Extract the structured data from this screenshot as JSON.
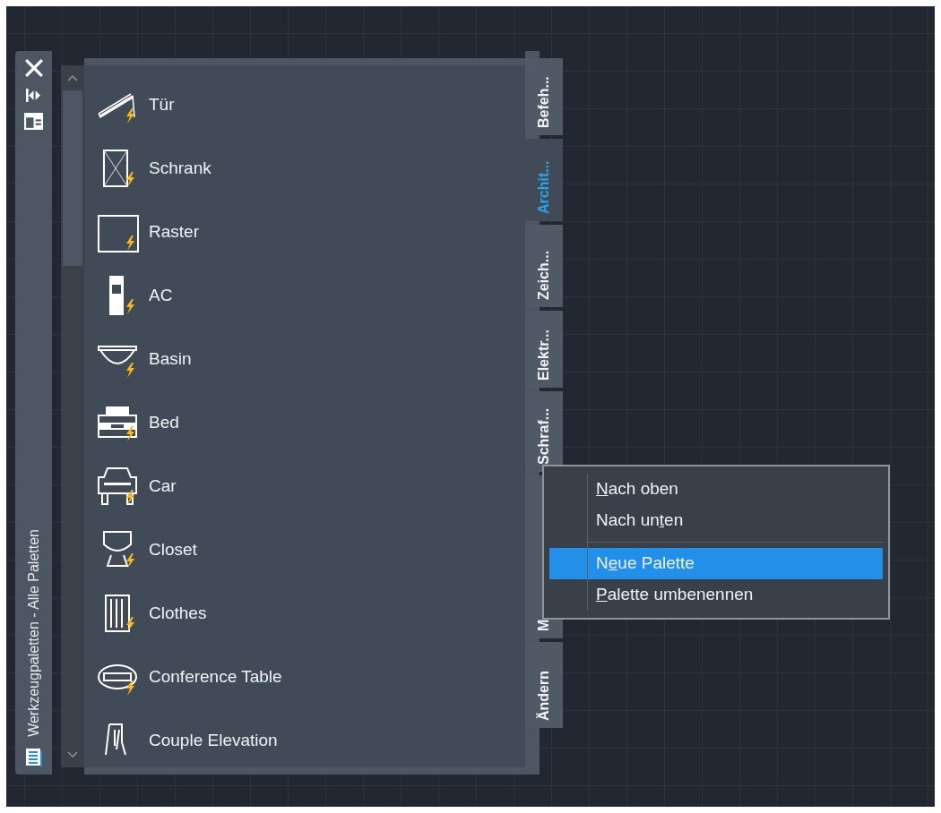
{
  "palette": {
    "title": "Werkzeugpaletten - Alle Paletten",
    "items": [
      {
        "label": "Tür"
      },
      {
        "label": "Schrank"
      },
      {
        "label": "Raster"
      },
      {
        "label": "AC"
      },
      {
        "label": "Basin"
      },
      {
        "label": "Bed"
      },
      {
        "label": "Car"
      },
      {
        "label": "Closet"
      },
      {
        "label": "Clothes"
      },
      {
        "label": "Conference Table"
      },
      {
        "label": "Couple Elevation"
      }
    ],
    "tabs": [
      {
        "label": "Befeh...",
        "selected": false
      },
      {
        "label": "Archit...",
        "selected": true
      },
      {
        "label": "Zeich...",
        "selected": false
      },
      {
        "label": "Elektr...",
        "selected": false
      },
      {
        "label": "Schraf...",
        "selected": false
      },
      {
        "label": "M",
        "selected": false
      },
      {
        "label": "Ändern",
        "selected": false
      }
    ]
  },
  "context_menu": {
    "items": [
      {
        "kind": "item",
        "key": "N",
        "after": "ach oben",
        "selected": false
      },
      {
        "kind": "item",
        "before": "Nach un",
        "key": "t",
        "after": "en",
        "selected": false
      },
      {
        "kind": "separator"
      },
      {
        "kind": "item",
        "before": "N",
        "key": "e",
        "after": "ue Palette",
        "selected": true
      },
      {
        "kind": "item",
        "key": "P",
        "after": "alette umbenennen",
        "selected": false
      }
    ]
  }
}
